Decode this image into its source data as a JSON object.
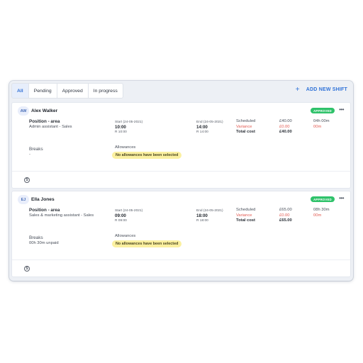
{
  "tabs": [
    {
      "label": "All"
    },
    {
      "label": "Pending"
    },
    {
      "label": "Approved"
    },
    {
      "label": "In progress"
    }
  ],
  "add_shift_label": "ADD NEW SHIFT",
  "labels": {
    "position": "Position - area",
    "breaks": "Breaks",
    "allowances": "Allowances",
    "scheduled": "Scheduled",
    "variance": "Variance",
    "total_cost": "Total cost"
  },
  "shifts": [
    {
      "initials": "AW",
      "name": "Alex Walker",
      "status": "APPROVED",
      "position": "Admin assistant - Sales",
      "start_label": "Start (24-05-2021)",
      "start_time": "10:00",
      "start_r": "R 10:00",
      "end_label": "End (24-05-2021)",
      "end_time": "14:00",
      "end_r": "R 14:00",
      "scheduled_amount": "£40.00",
      "variance_amount": "£0.00",
      "total_amount": "£40.00",
      "scheduled_time": "04h 00m",
      "variance_time": "00m",
      "breaks": "-",
      "allowance_note": "No allowances have been selected"
    },
    {
      "initials": "EJ",
      "name": "Ella Jones",
      "status": "APPROVED",
      "position": "Sales & marketing assistant - Sales",
      "start_label": "Start (24-05-2021)",
      "start_time": "09:00",
      "start_r": "R 09:00",
      "end_label": "End (24-05-2021)",
      "end_time": "18:00",
      "end_r": "R 18:00",
      "scheduled_amount": "£65.00",
      "variance_amount": "£0.00",
      "total_amount": "£65.00",
      "scheduled_time": "08h 30m",
      "variance_time": "00m",
      "breaks": "00h 30m unpaid",
      "allowance_note": "No allowances have been selected"
    }
  ],
  "colors": {
    "accent": "#2f72d8",
    "approved": "#2fc26a",
    "variance": "#e25b52",
    "pill": "#fbf0a0"
  },
  "icons": {
    "more": "ellipsis-icon",
    "cost": "dollar-icon",
    "add": "plus-icon"
  }
}
